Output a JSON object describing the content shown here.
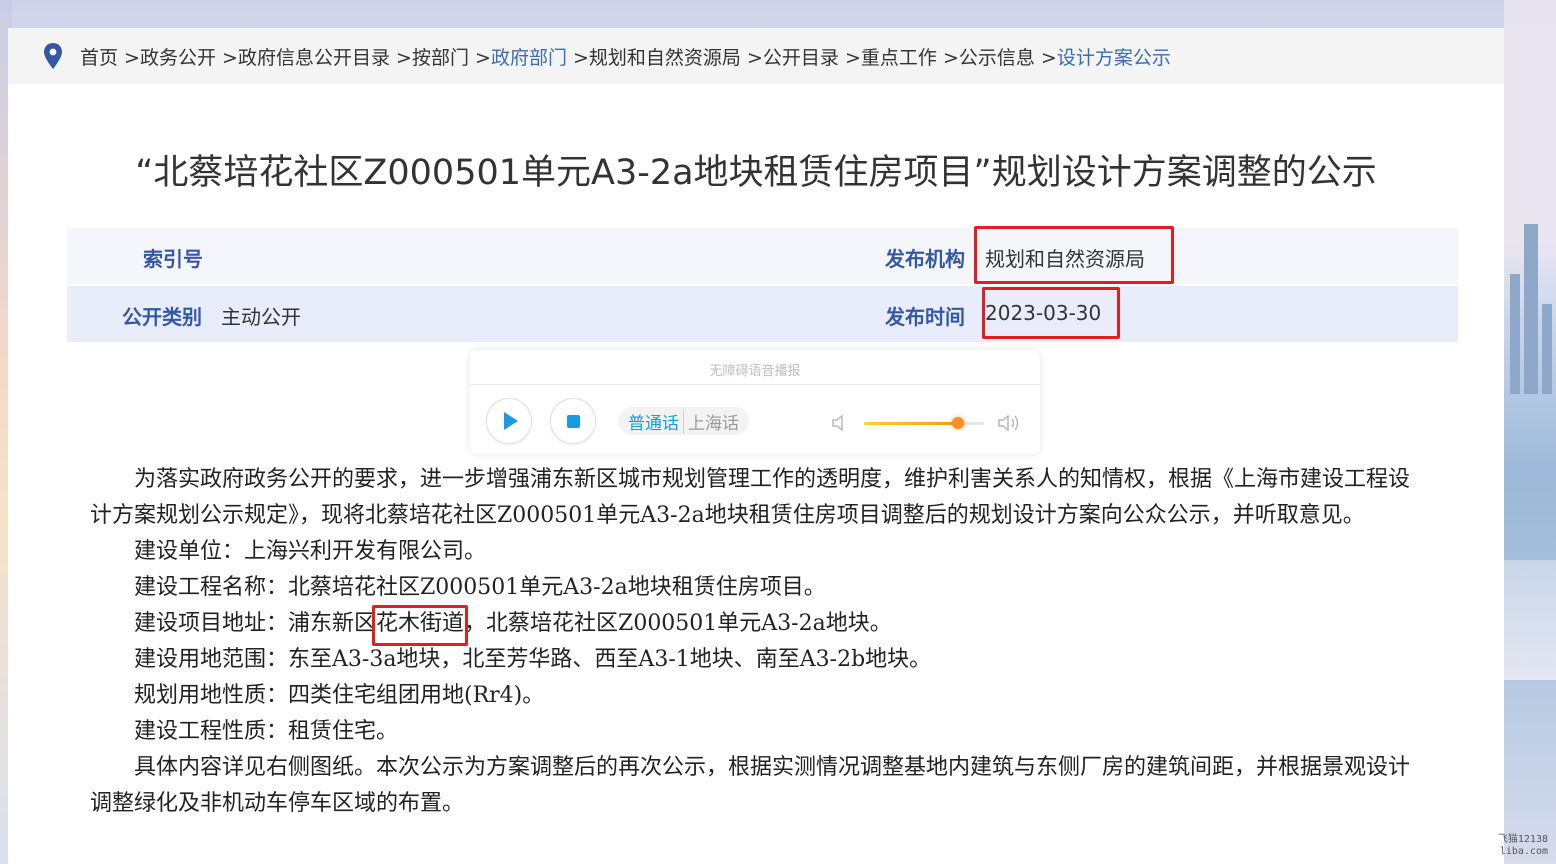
{
  "breadcrumb": {
    "items": [
      {
        "label": "首页",
        "sep": ""
      },
      {
        "label": "政务公开",
        "sep": ">"
      },
      {
        "label": "政府信息公开目录",
        "sep": ">"
      },
      {
        "label": "按部门",
        "sep": ">"
      },
      {
        "label": "政府部门",
        "sep": ">"
      },
      {
        "label": "规划和自然资源局",
        "sep": ">"
      },
      {
        "label": "公开目录",
        "sep": ">"
      },
      {
        "label": "重点工作",
        "sep": ">"
      },
      {
        "label": "公示信息",
        "sep": ">"
      },
      {
        "label": "设计方案公示",
        "sep": ">"
      }
    ],
    "link_color": "#3b6cb8"
  },
  "article": {
    "title": "“北蔡培花社区Z000501单元A3-2a地块租赁住房项目”规划设计方案调整的公示"
  },
  "meta": {
    "index_label": "索引号",
    "index_value": "",
    "publisher_label": "发布机构",
    "publisher_value": "规划和自然资源局",
    "category_label": "公开类别",
    "category_value": "主动公开",
    "date_label": "发布时间",
    "date_value": "2023-03-30",
    "label_color": "#3558a6",
    "highlight_color": "#e02020"
  },
  "player": {
    "title": "无障碍语音播报",
    "lang_active": "普通话",
    "lang_other": "上海话",
    "volume": 0.78,
    "accent": "#1a9be0"
  },
  "body": {
    "p1": "为落实政府政务公开的要求，进一步增强浦东新区城市规划管理工作的透明度，维护利害关系人的知情权，根据《上海市建设工程设计方案规划公示规定》，现将北蔡培花社区Z000501单元A3-2a地块租赁住房项目调整后的规划设计方案向公众公示，并听取意见。",
    "p2": "建设单位：上海兴利开发有限公司。",
    "p3": "建设工程名称：北蔡培花社区Z000501单元A3-2a地块租赁住房项目。",
    "p4_a": "建设项目地址：浦东新区",
    "p4_hl": "花木街道",
    "p4_b": "，北蔡培花社区Z000501单元A3-2a地块。",
    "p5": "建设用地范围：东至A3-3a地块，北至芳华路、西至A3-1地块、南至A3-2b地块。",
    "p6": "规划用地性质：四类住宅组团用地(Rr4)。",
    "p7": "建设工程性质：租赁住宅。",
    "p8": "具体内容详见右侧图纸。本次公示为方案调整后的再次公示，根据实测情况调整基地内建筑与东侧厂房的建筑间距，并根据景观设计调整绿化及非机动车停车区域的布置。"
  },
  "watermark": {
    "line1": "飞猫12138",
    "line2": "liba.com"
  }
}
